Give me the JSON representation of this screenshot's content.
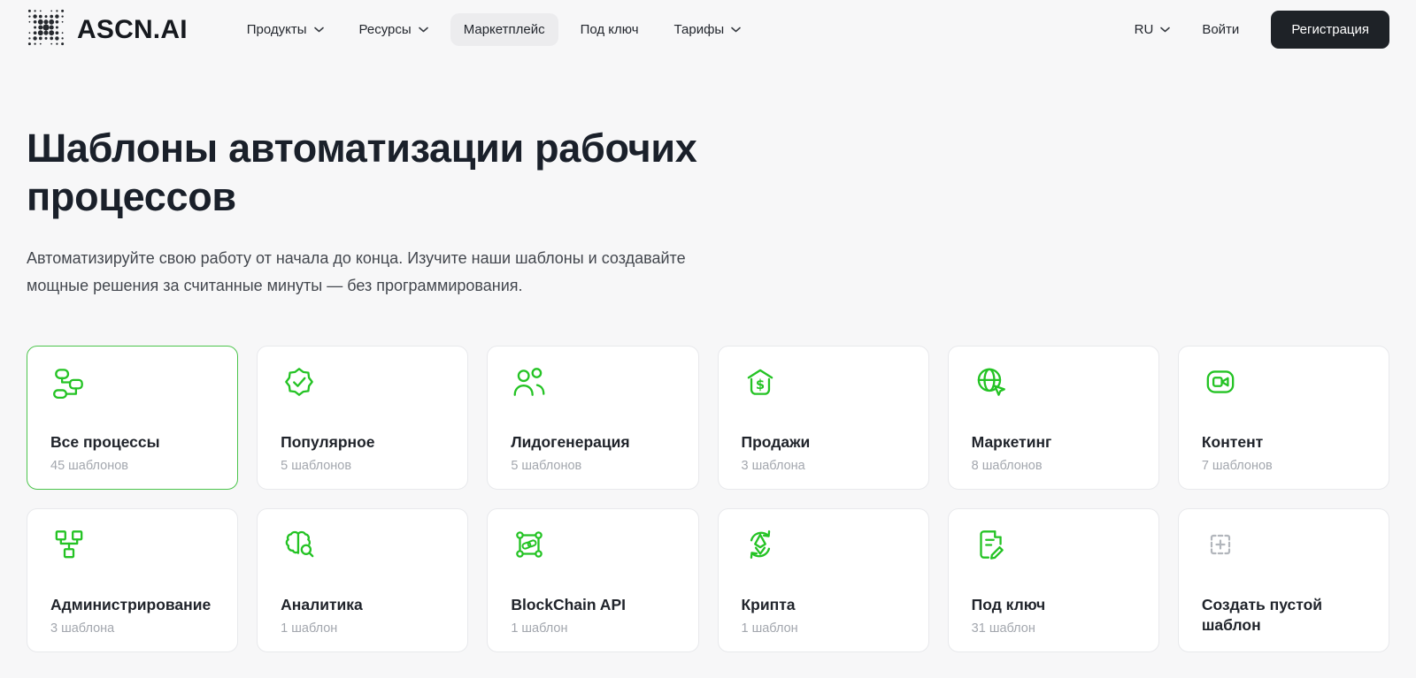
{
  "brand": {
    "name": "ASCN.AI"
  },
  "nav": {
    "items": [
      {
        "label": "Продукты",
        "has_dropdown": true,
        "active": false
      },
      {
        "label": "Ресурсы",
        "has_dropdown": true,
        "active": false
      },
      {
        "label": "Маркетплейс",
        "has_dropdown": false,
        "active": true
      },
      {
        "label": "Под ключ",
        "has_dropdown": false,
        "active": false
      },
      {
        "label": "Тарифы",
        "has_dropdown": true,
        "active": false
      }
    ]
  },
  "header_right": {
    "language": "RU",
    "login_label": "Войти",
    "signup_label": "Регистрация"
  },
  "hero": {
    "title": "Шаблоны автоматизации рабочих процессов",
    "subtitle": "Автоматизируйте свою работу от начала до конца. Изучите наши шаблоны и создавайте мощные решения за считанные минуты — без программирования."
  },
  "categories": [
    {
      "title": "Все процессы",
      "count": "45 шаблонов",
      "icon": "workflow-icon",
      "selected": true
    },
    {
      "title": "Популярное",
      "count": "5 шаблонов",
      "icon": "badge-check-icon",
      "selected": false
    },
    {
      "title": "Лидогенерация",
      "count": "5 шаблонов",
      "icon": "users-icon",
      "selected": false
    },
    {
      "title": "Продажи",
      "count": "3 шаблона",
      "icon": "sales-dollar-icon",
      "selected": false
    },
    {
      "title": "Маркетинг",
      "count": "8 шаблонов",
      "icon": "globe-cursor-icon",
      "selected": false
    },
    {
      "title": "Контент",
      "count": "7 шаблонов",
      "icon": "video-camera-icon",
      "selected": false
    },
    {
      "title": "Администрирование",
      "count": "3 шаблона",
      "icon": "org-chart-icon",
      "selected": false
    },
    {
      "title": "Аналитика",
      "count": "1 шаблон",
      "icon": "brain-search-icon",
      "selected": false
    },
    {
      "title": "BlockChain API",
      "count": "1 шаблон",
      "icon": "blockchain-icon",
      "selected": false
    },
    {
      "title": "Крипта",
      "count": "1 шаблон",
      "icon": "crypto-refresh-icon",
      "selected": false
    },
    {
      "title": "Под ключ",
      "count": "31 шаблон",
      "icon": "document-edit-icon",
      "selected": false
    },
    {
      "title": "Создать пустой шаблон",
      "count": "",
      "icon": "add-template-icon",
      "selected": false
    }
  ],
  "colors": {
    "accent_green": "#24c324",
    "selected_border": "#4cc44c",
    "dark_button": "#1e2227",
    "page_bg": "#f7f7f8",
    "muted_text": "#a3a7ae"
  }
}
